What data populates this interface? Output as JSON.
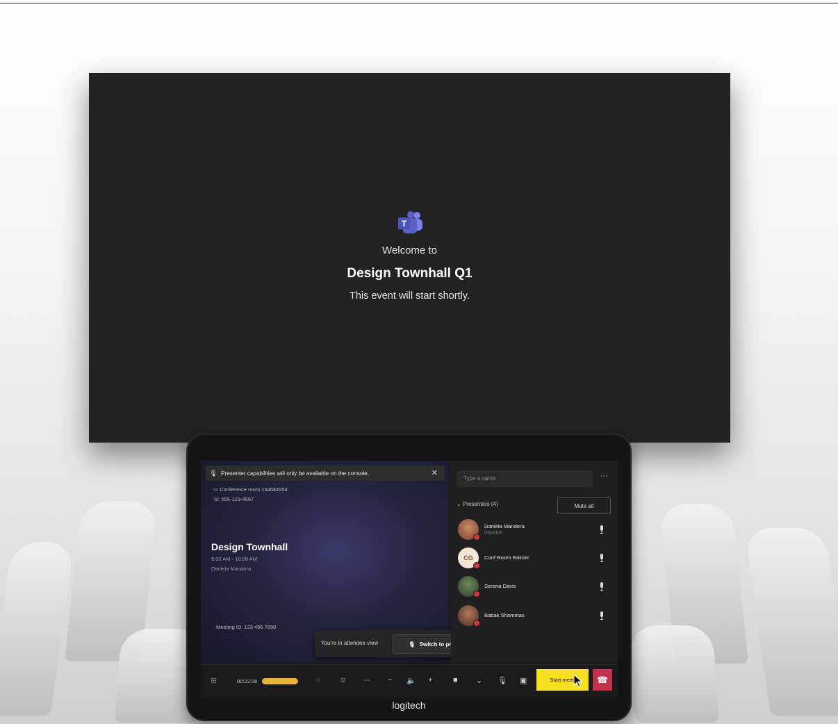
{
  "tv": {
    "welcome": "Welcome to",
    "title": "Design Townhall Q1",
    "subtitle": "This event will start shortly."
  },
  "console": {
    "banner": "Presenter capabilities will only be available on the console.",
    "room": "Conference room 154684354",
    "phone": "555-123-4567",
    "meeting_title": "Design Townhall",
    "time": "9:00 AM - 10:00 AM",
    "organizer": "Daniela Mandera",
    "meeting_id": "Meeting ID: 123 456 7890",
    "attendee_text": "You're in attendee view",
    "switch_label": "Switch to presenter view",
    "search_placeholder": "Type a name",
    "presenters_label": "Presenters (4)",
    "mute_all": "Mute all",
    "participants": [
      {
        "name": "Daniela Mandera",
        "role": "Organizer",
        "initials": ""
      },
      {
        "name": "Conf Room Rainier",
        "role": "",
        "initials": "CG"
      },
      {
        "name": "Serena Davis",
        "role": "",
        "initials": ""
      },
      {
        "name": "Babak Shammas",
        "role": "",
        "initials": ""
      }
    ],
    "timer": "00:22:06",
    "start_label": "Start meeti",
    "brand": "logitech"
  },
  "colors": {
    "accent": "#5b5fc7",
    "start": "#f6e020",
    "hangup": "#c4314b"
  }
}
